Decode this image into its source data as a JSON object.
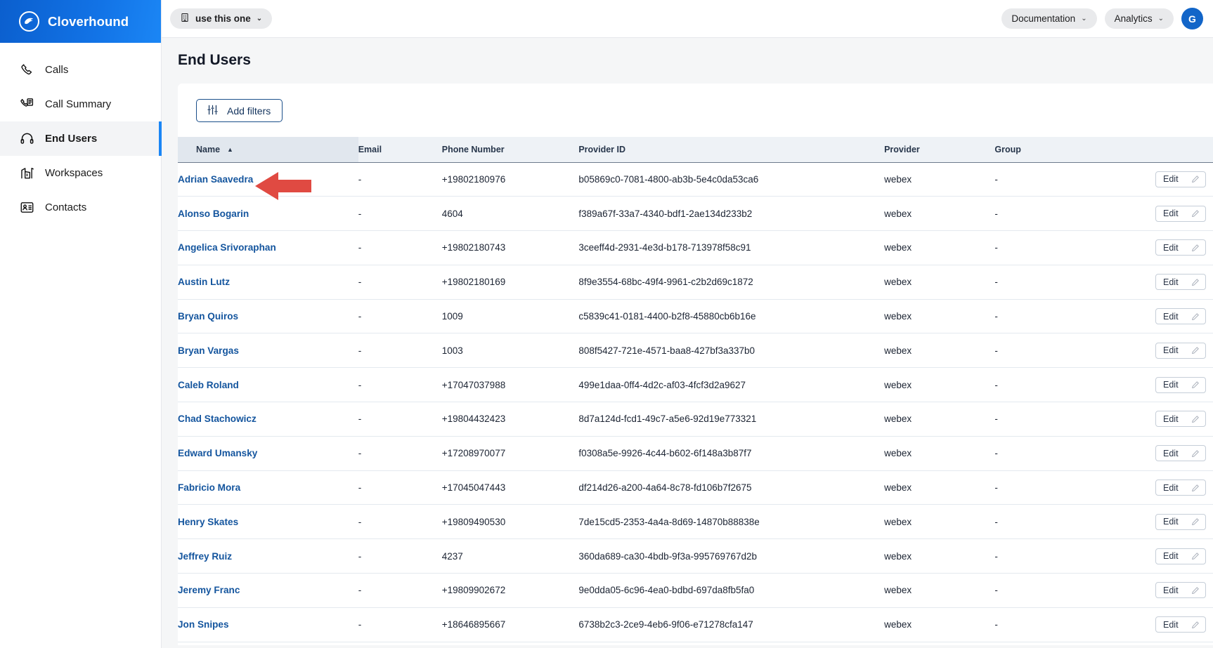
{
  "brand": {
    "name": "Cloverhound",
    "logo_icon": "cloverhound-logo-icon"
  },
  "sidebar": {
    "items": [
      {
        "label": "Calls",
        "icon": "phone-icon",
        "active": false
      },
      {
        "label": "Call Summary",
        "icon": "phone-document-icon",
        "active": false
      },
      {
        "label": "End Users",
        "icon": "headset-icon",
        "active": true
      },
      {
        "label": "Workspaces",
        "icon": "building-chart-icon",
        "active": false
      },
      {
        "label": "Contacts",
        "icon": "contact-card-icon",
        "active": false
      }
    ]
  },
  "topbar": {
    "org_selector": {
      "label": "use this one",
      "icon": "building-icon",
      "caret": "⌄"
    },
    "documentation": {
      "label": "Documentation",
      "caret": "⌄"
    },
    "analytics": {
      "label": "Analytics",
      "caret": "⌄"
    },
    "avatar_initial": "G"
  },
  "page": {
    "title": "End Users",
    "add_filters_label": "Add filters",
    "add_filters_icon": "sliders-icon"
  },
  "table": {
    "columns": [
      {
        "key": "name",
        "label": "Name",
        "sorted": true,
        "sort_dir": "asc",
        "sort_caret": "▲"
      },
      {
        "key": "email",
        "label": "Email"
      },
      {
        "key": "phone",
        "label": "Phone Number"
      },
      {
        "key": "pid",
        "label": "Provider ID"
      },
      {
        "key": "prov",
        "label": "Provider"
      },
      {
        "key": "group",
        "label": "Group"
      },
      {
        "key": "action",
        "label": ""
      }
    ],
    "edit_label": "Edit",
    "edit_icon": "pencil-icon",
    "rows": [
      {
        "name": "Adrian Saavedra",
        "email": "-",
        "phone": "+19802180976",
        "pid": "b05869c0-7081-4800-ab3b-5e4c0da53ca6",
        "prov": "webex",
        "group": "-"
      },
      {
        "name": "Alonso Bogarin",
        "email": "-",
        "phone": "4604",
        "pid": "f389a67f-33a7-4340-bdf1-2ae134d233b2",
        "prov": "webex",
        "group": "-"
      },
      {
        "name": "Angelica Srivoraphan",
        "email": "-",
        "phone": "+19802180743",
        "pid": "3ceeff4d-2931-4e3d-b178-713978f58c91",
        "prov": "webex",
        "group": "-"
      },
      {
        "name": "Austin Lutz",
        "email": "-",
        "phone": "+19802180169",
        "pid": "8f9e3554-68bc-49f4-9961-c2b2d69c1872",
        "prov": "webex",
        "group": "-"
      },
      {
        "name": "Bryan Quiros",
        "email": "-",
        "phone": "1009",
        "pid": "c5839c41-0181-4400-b2f8-45880cb6b16e",
        "prov": "webex",
        "group": "-"
      },
      {
        "name": "Bryan Vargas",
        "email": "-",
        "phone": "1003",
        "pid": "808f5427-721e-4571-baa8-427bf3a337b0",
        "prov": "webex",
        "group": "-"
      },
      {
        "name": "Caleb Roland",
        "email": "-",
        "phone": "+17047037988",
        "pid": "499e1daa-0ff4-4d2c-af03-4fcf3d2a9627",
        "prov": "webex",
        "group": "-"
      },
      {
        "name": "Chad Stachowicz",
        "email": "-",
        "phone": "+19804432423",
        "pid": "8d7a124d-fcd1-49c7-a5e6-92d19e773321",
        "prov": "webex",
        "group": "-"
      },
      {
        "name": "Edward Umansky",
        "email": "-",
        "phone": "+17208970077",
        "pid": "f0308a5e-9926-4c44-b602-6f148a3b87f7",
        "prov": "webex",
        "group": "-"
      },
      {
        "name": "Fabricio Mora",
        "email": "-",
        "phone": "+17045047443",
        "pid": "df214d26-a200-4a64-8c78-fd106b7f2675",
        "prov": "webex",
        "group": "-"
      },
      {
        "name": "Henry Skates",
        "email": "-",
        "phone": "+19809490530",
        "pid": "7de15cd5-2353-4a4a-8d69-14870b88838e",
        "prov": "webex",
        "group": "-"
      },
      {
        "name": "Jeffrey Ruiz",
        "email": "-",
        "phone": "4237",
        "pid": "360da689-ca30-4bdb-9f3a-995769767d2b",
        "prov": "webex",
        "group": "-"
      },
      {
        "name": "Jeremy Franc",
        "email": "-",
        "phone": "+19809902672",
        "pid": "9e0dda05-6c96-4ea0-bdbd-697da8fb5fa0",
        "prov": "webex",
        "group": "-"
      },
      {
        "name": "Jon Snipes",
        "email": "-",
        "phone": "+18646895667",
        "pid": "6738b2c3-2ce9-4eb6-9f06-e71278cfa147",
        "prov": "webex",
        "group": "-"
      }
    ]
  },
  "annotation": {
    "type": "left-arrow",
    "color": "#e04a42"
  },
  "colors": {
    "brand_blue": "#1273e6",
    "link_blue": "#14559e",
    "active_nav_bar": "#1b86f5",
    "header_bg": "#eef2f6",
    "arrow_red": "#e04a42"
  }
}
